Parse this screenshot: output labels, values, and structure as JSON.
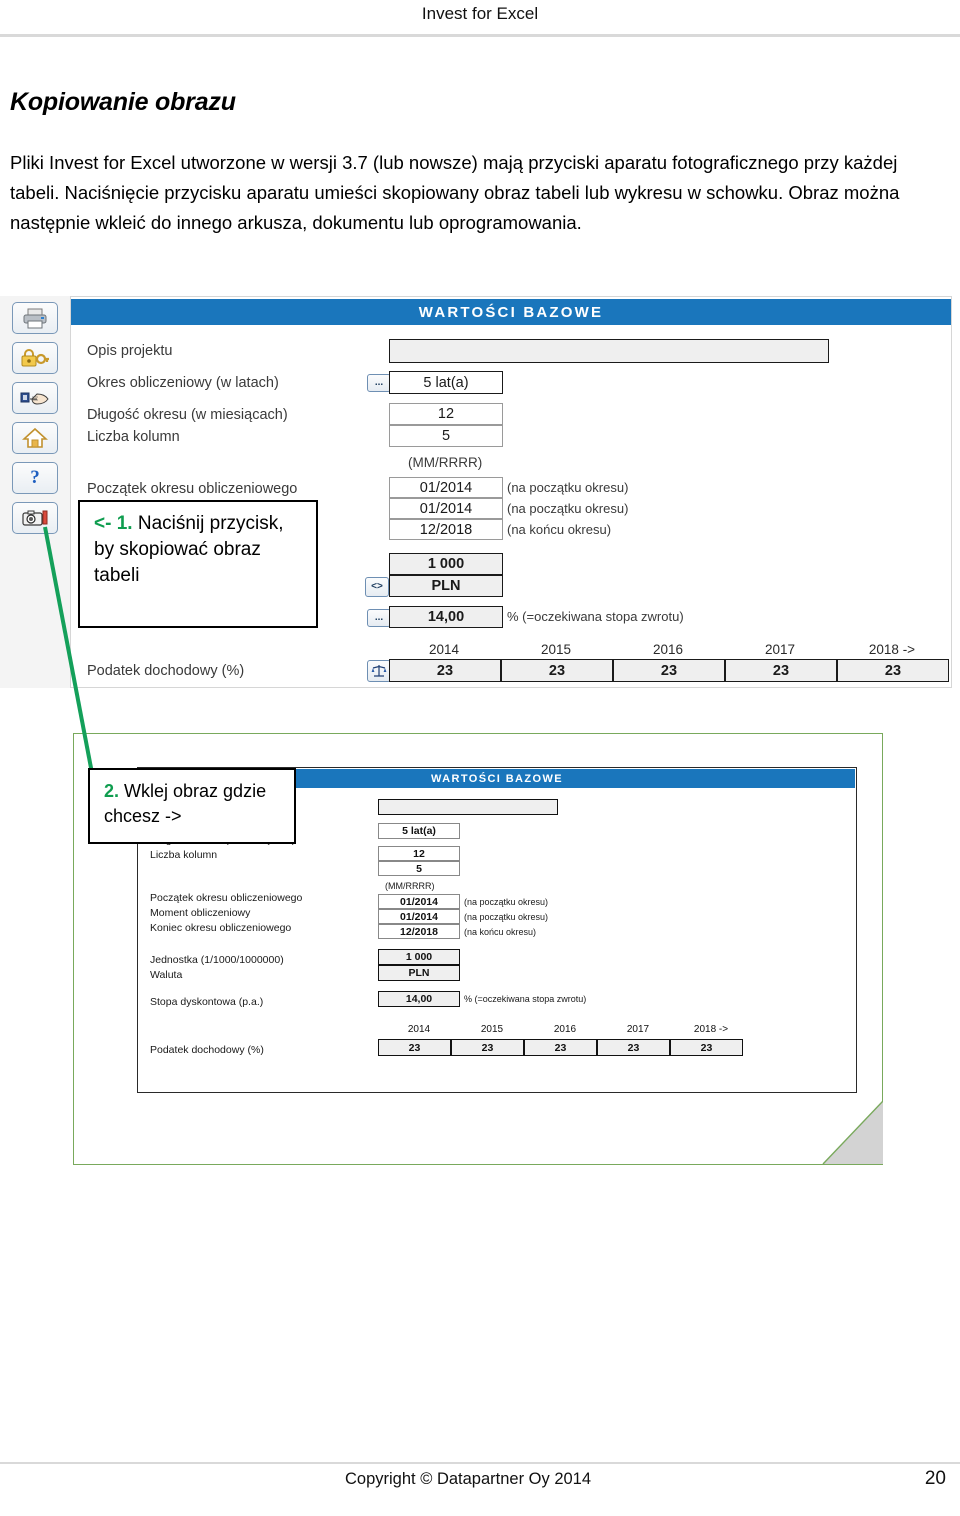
{
  "header": {
    "title": "Invest for Excel"
  },
  "heading": "Kopiowanie obrazu",
  "intro": "Pliki Invest for Excel utworzone w wersji 3.7 (lub nowsze) mają przyciski aparatu fotograficznego przy każdej tabeli. Naciśnięcie przycisku aparatu umieści skopiowany obraz tabeli lub wykresu w schowku. Obraz można następnie wkleić do innego arkusza, dokumentu lub oprogramowania.",
  "colors": {
    "header_blue": "#1a76bc",
    "accent_green": "#0f9d4f",
    "frame_green": "#79a95c",
    "cell_grey": "#efefef"
  },
  "toolbar": {
    "buttons": [
      {
        "icon": "printer-icon",
        "label": "Drukuj"
      },
      {
        "icon": "lock-key-icon",
        "label": "Blokada"
      },
      {
        "icon": "pointing-hand-icon",
        "label": "Wskaźnik"
      },
      {
        "icon": "home-icon",
        "label": "Strona główna"
      },
      {
        "icon": "question-mark-icon",
        "label": "?"
      },
      {
        "icon": "camera-icon",
        "label": "Kopiuj obraz"
      }
    ]
  },
  "callouts": [
    {
      "mark": "<- 1.",
      "text": " Naciśnij przycisk, by skopiować obraz tabeli"
    },
    {
      "mark": "2.",
      "text": " Wklej obraz gdzie chcesz ->"
    }
  ],
  "sheet": {
    "title": "WARTOŚCI BAZOWE",
    "rows": [
      {
        "label": "Opis projektu",
        "value": "",
        "note": "",
        "button": ""
      },
      {
        "label": "Okres obliczeniowy (w latach)",
        "value": "5 lat(a)",
        "note": "",
        "button": "..."
      },
      {
        "label": "Długość okresu (w miesiącach)",
        "value": "12",
        "note": "",
        "button": ""
      },
      {
        "label": "Liczba kolumn",
        "value": "5",
        "note": "",
        "button": ""
      },
      {
        "label": "",
        "value": "(MM/RRRR)",
        "note": "",
        "button": ""
      },
      {
        "label": "Początek okresu obliczeniowego",
        "value": "01/2014",
        "note": "(na początku okresu)",
        "button": ""
      },
      {
        "label": "Moment obliczeniowy",
        "value": "01/2014",
        "note": "(na początku okresu)",
        "button": ""
      },
      {
        "label": "Koniec okresu obliczeniowego",
        "value": "12/2018",
        "note": "(na końcu okresu)",
        "button": ""
      },
      {
        "label": "Jednostka (1/1000/1000000)",
        "value": "1 000",
        "note": "",
        "button": ""
      },
      {
        "label": "Waluta",
        "value": "PLN",
        "note": "",
        "button": "<>"
      },
      {
        "label": "Stopa dyskontowa (p.a.)",
        "value": "14,00",
        "note": "% (=oczekiwana stopa zwrotu)",
        "button": "..."
      },
      {
        "label": "Podatek dochodowy (%)",
        "value": "",
        "note": "",
        "button": "scales-icon"
      }
    ],
    "tax_years": [
      "2014",
      "2015",
      "2016",
      "2017",
      "2018 ->"
    ],
    "tax_values": [
      "23",
      "23",
      "23",
      "23",
      "23"
    ],
    "mm_rrrr": "(MM/RRRR)"
  },
  "footer": {
    "copyright": "Copyright © Datapartner Oy 2014",
    "page": "20"
  }
}
